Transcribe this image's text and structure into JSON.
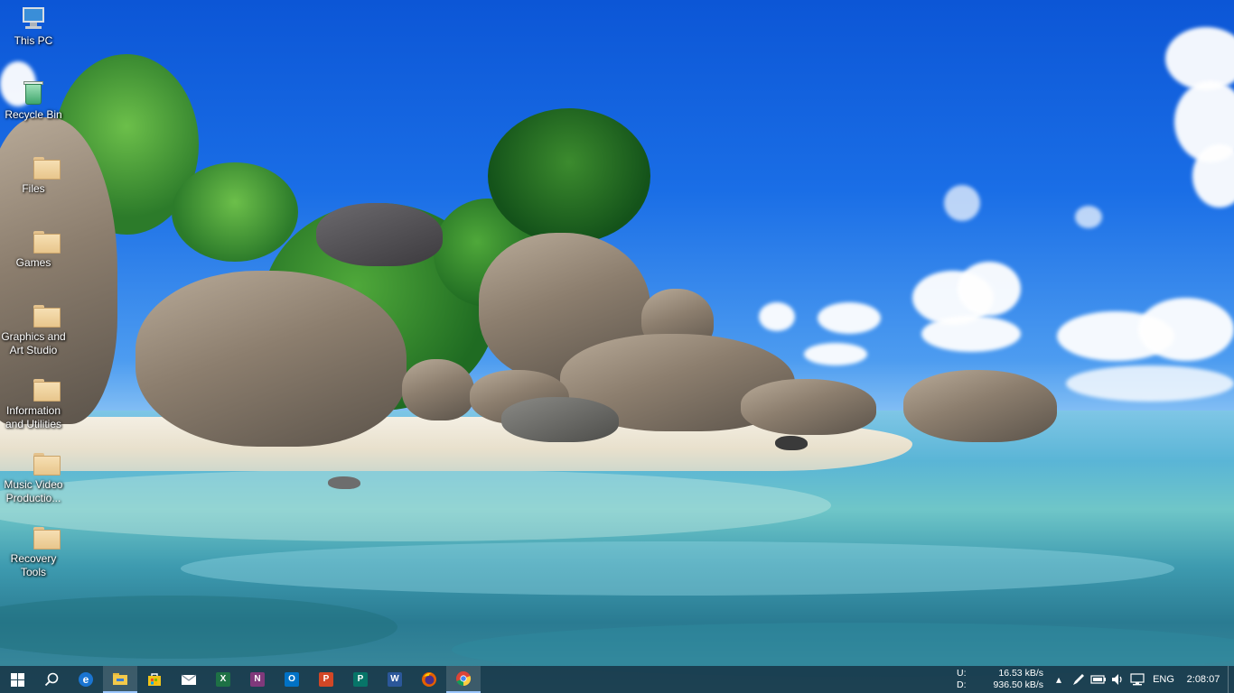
{
  "desktop": {
    "icons": [
      {
        "label": "This PC",
        "icon": "computer-icon"
      },
      {
        "label": "Recycle Bin",
        "icon": "recycle-bin-icon"
      },
      {
        "label": "Files",
        "icon": "folder-icon"
      },
      {
        "label": "Games",
        "icon": "folder-icon"
      },
      {
        "label": "Graphics and Art Studio",
        "icon": "folder-icon"
      },
      {
        "label": "Information and Utilities",
        "icon": "folder-icon"
      },
      {
        "label": "Music Video Productio...",
        "icon": "folder-icon"
      },
      {
        "label": "Recovery Tools",
        "icon": "folder-icon"
      }
    ]
  },
  "taskbar": {
    "apps": [
      {
        "name": "Start",
        "icon": "windows-start-icon"
      },
      {
        "name": "Search",
        "icon": "search-icon"
      },
      {
        "name": "Microsoft Edge",
        "icon": "edge-icon",
        "glyph": "e",
        "color": "#1a75d2"
      },
      {
        "name": "File Explorer",
        "icon": "file-explorer-icon",
        "color": "#f3c94a"
      },
      {
        "name": "Microsoft Store",
        "icon": "store-icon",
        "color": "#f0c419"
      },
      {
        "name": "Mail",
        "icon": "mail-icon",
        "color": "#ffffff"
      },
      {
        "name": "Excel",
        "icon": "excel-icon",
        "glyph": "X",
        "color": "#1e7145"
      },
      {
        "name": "OneNote",
        "icon": "onenote-icon",
        "glyph": "N",
        "color": "#80397b"
      },
      {
        "name": "Outlook",
        "icon": "outlook-icon",
        "glyph": "O",
        "color": "#0072c6"
      },
      {
        "name": "PowerPoint",
        "icon": "powerpoint-icon",
        "glyph": "P",
        "color": "#d24726"
      },
      {
        "name": "Publisher",
        "icon": "publisher-icon",
        "glyph": "P",
        "color": "#077568"
      },
      {
        "name": "Word",
        "icon": "word-icon",
        "glyph": "W",
        "color": "#2b579a"
      },
      {
        "name": "Firefox",
        "icon": "firefox-icon",
        "color": "#e66000"
      },
      {
        "name": "Chrome",
        "icon": "chrome-icon",
        "color": "#4285f4"
      }
    ],
    "tray": {
      "upload_label": "U:",
      "upload_speed": "16.53 kB/s",
      "download_label": "D:",
      "download_speed": "936.50 kB/s",
      "language": "ENG",
      "time": "2:08:07"
    }
  }
}
